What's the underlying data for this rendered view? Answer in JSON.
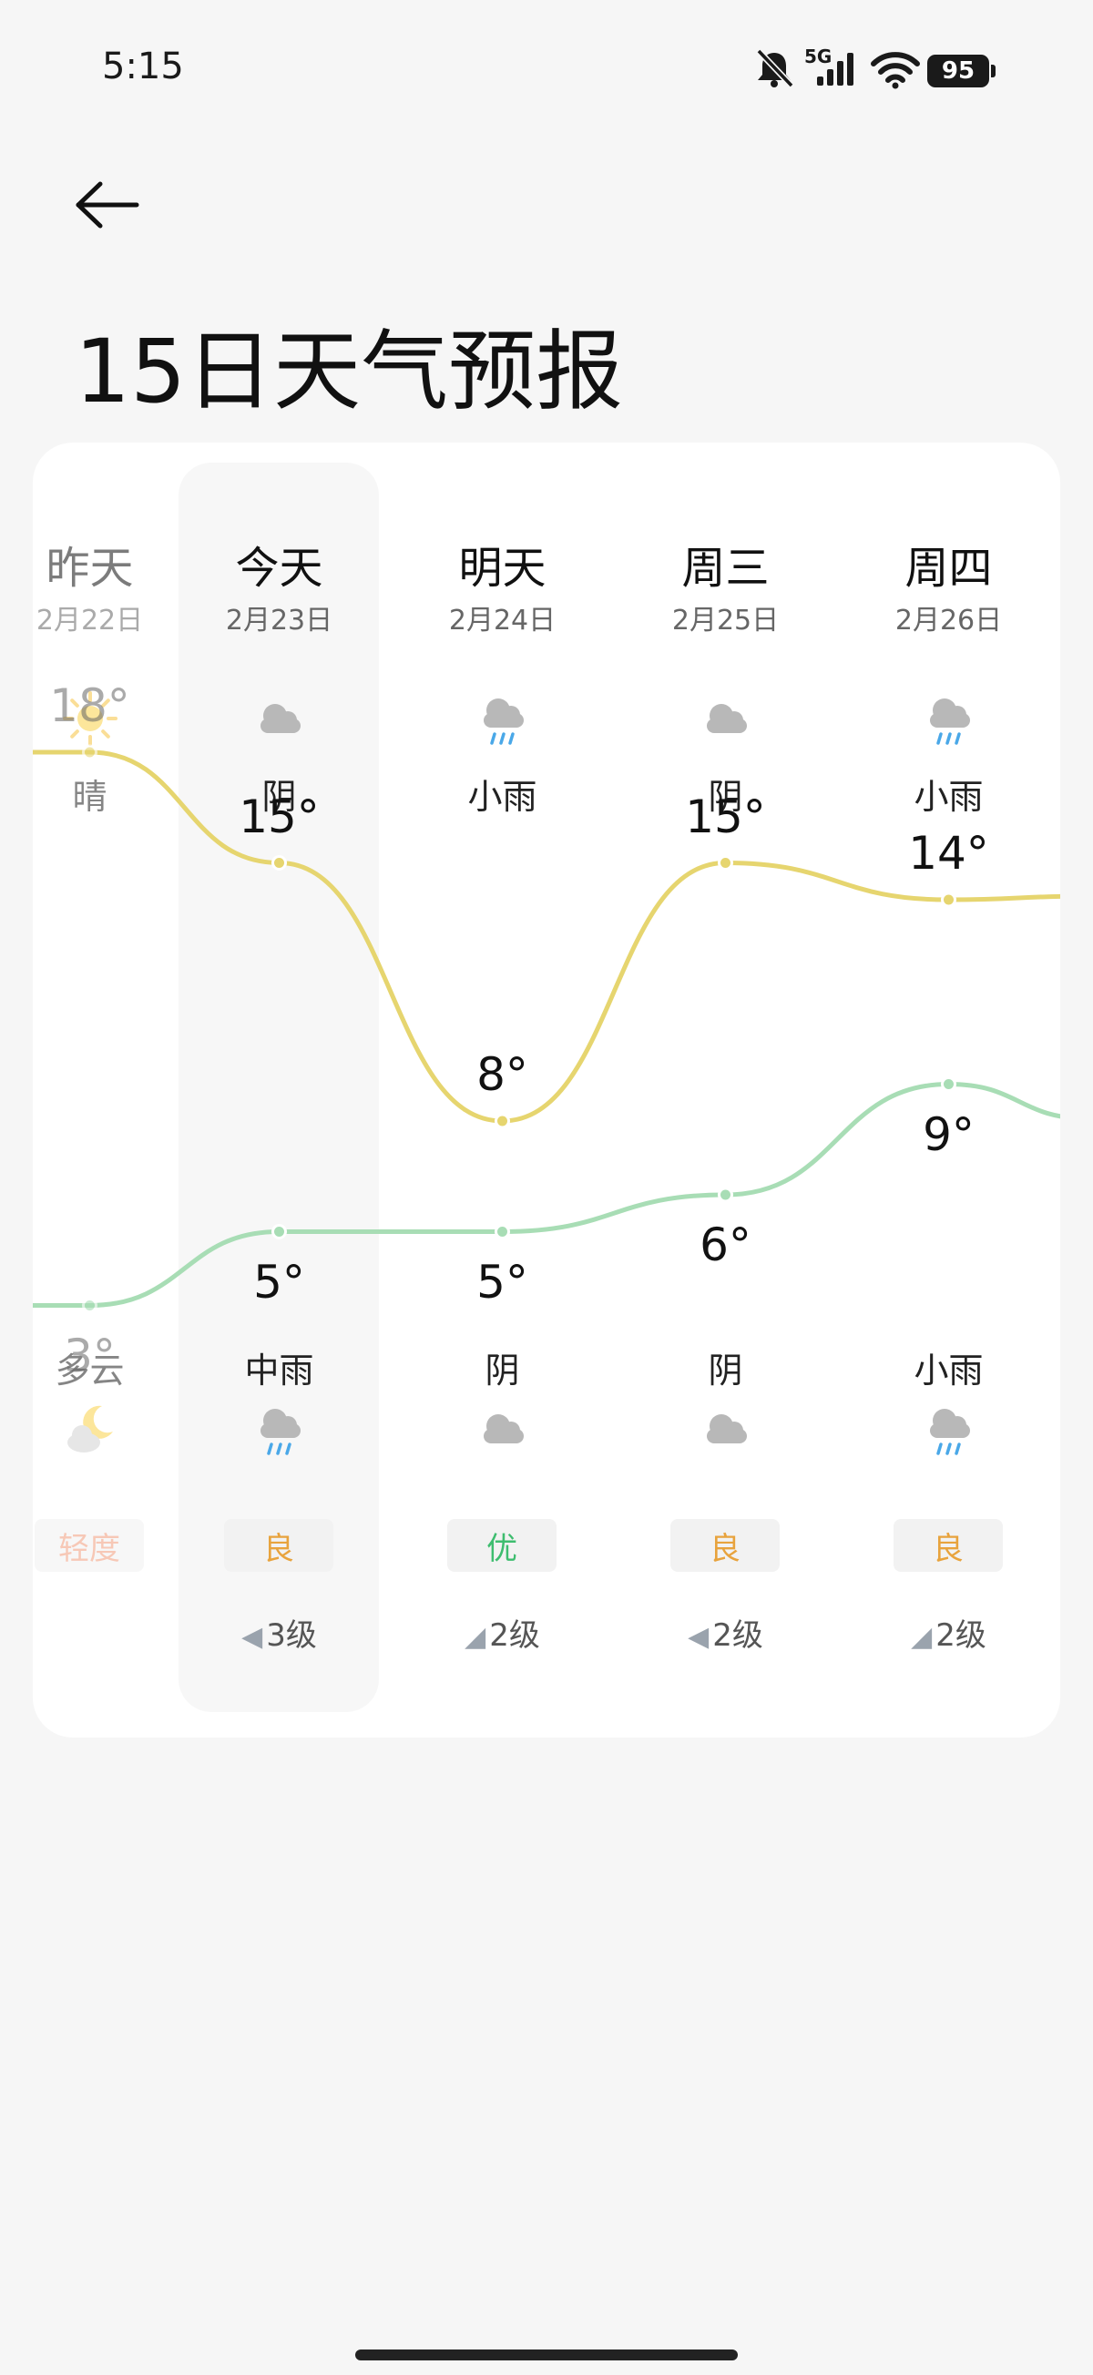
{
  "status_bar": {
    "time": "5:15",
    "network": "5G",
    "battery": "95"
  },
  "header": {
    "title": "15日天气预报"
  },
  "days": [
    {
      "name": "昨天",
      "date": "2月22日",
      "day_icon": "sun-icon",
      "day_condition": "晴",
      "high": "18°",
      "low": "3°",
      "night_condition": "多云",
      "night_icon": "moon-cloud-icon",
      "aqi": "轻度",
      "aqi_class": "mild",
      "wind": ""
    },
    {
      "name": "今天",
      "date": "2月23日",
      "day_icon": "cloud-icon",
      "day_condition": "阴",
      "high": "15°",
      "low": "5°",
      "night_condition": "中雨",
      "night_icon": "rain-cloud-icon",
      "aqi": "良",
      "aqi_class": "good",
      "wind": "3级",
      "wind_arrow": "◀"
    },
    {
      "name": "明天",
      "date": "2月24日",
      "day_icon": "rain-cloud-icon",
      "day_condition": "小雨",
      "high": "8°",
      "low": "5°",
      "night_condition": "阴",
      "night_icon": "cloud-icon",
      "aqi": "优",
      "aqi_class": "excellent",
      "wind": "2级",
      "wind_arrow": "◢"
    },
    {
      "name": "周三",
      "date": "2月25日",
      "day_icon": "cloud-icon",
      "day_condition": "阴",
      "high": "15°",
      "low": "6°",
      "night_condition": "阴",
      "night_icon": "cloud-icon",
      "aqi": "良",
      "aqi_class": "good",
      "wind": "2级",
      "wind_arrow": "◀"
    },
    {
      "name": "周四",
      "date": "2月26日",
      "day_icon": "rain-cloud-icon",
      "day_condition": "小雨",
      "high": "14°",
      "low": "9°",
      "night_condition": "小雨",
      "night_icon": "rain-cloud-icon",
      "aqi": "良",
      "aqi_class": "good",
      "wind": "2级",
      "wind_arrow": "◢"
    }
  ],
  "chart_data": {
    "type": "line",
    "categories": [
      "2月22日",
      "2月23日",
      "2月24日",
      "2月25日",
      "2月26日"
    ],
    "series": [
      {
        "values": [
          18,
          15,
          8,
          15,
          14
        ],
        "color": "#e6d56f"
      },
      {
        "values": [
          3,
          5,
          5,
          6,
          9
        ],
        "color": "#a8ddb5"
      }
    ]
  },
  "colors": {
    "high_line": "#e6d56f",
    "low_line": "#a8ddb5",
    "background": "#f6f6f6",
    "card": "#ffffff"
  }
}
